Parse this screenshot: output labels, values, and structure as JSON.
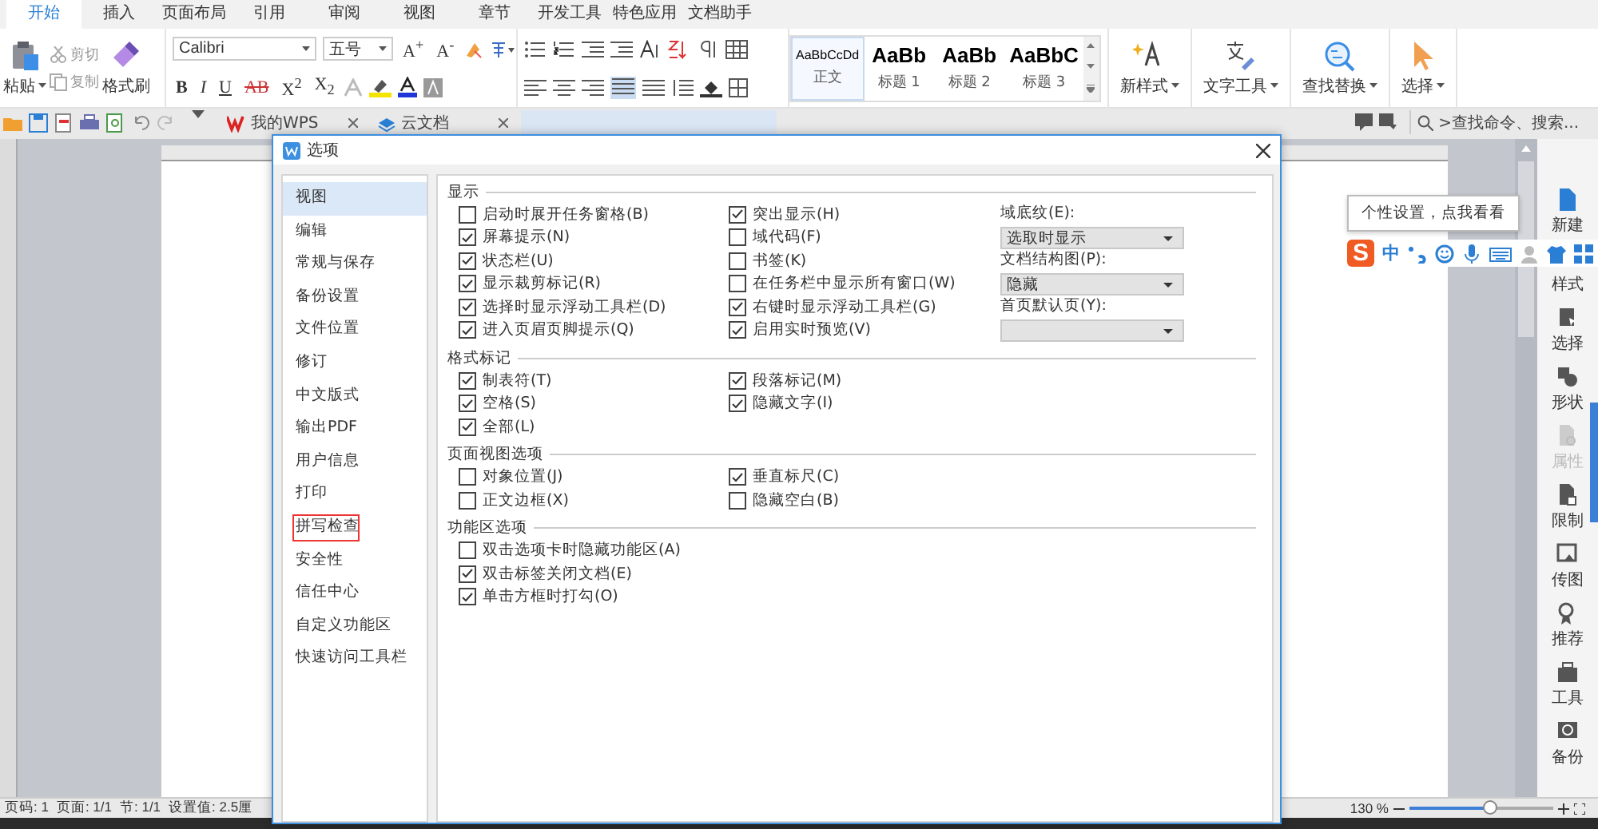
{
  "ribbon_tabs": [
    {
      "label": "开始",
      "selected": true
    },
    {
      "label": "插入",
      "selected": false
    },
    {
      "label": "页面布局",
      "selected": false
    },
    {
      "label": "引用",
      "selected": false
    },
    {
      "label": "审阅",
      "selected": false
    },
    {
      "label": "视图",
      "selected": false
    },
    {
      "label": "章节",
      "selected": false
    },
    {
      "label": "开发工具",
      "selected": false
    },
    {
      "label": "特色应用",
      "selected": false
    },
    {
      "label": "文档助手",
      "selected": false
    }
  ],
  "clipboard": {
    "paste": "粘贴",
    "cut": "剪切",
    "copy": "复制",
    "format_painter": "格式刷"
  },
  "font": {
    "name": "Calibri",
    "size": "五号",
    "size_buttons": [
      "A$^{+}$",
      "A$^{-}$"
    ],
    "format_buttons": [
      "B",
      "I",
      "U",
      "AB",
      "X$^{2}$",
      "X$_{2}$"
    ]
  },
  "styles": [
    {
      "sample": "AaBbCcDd",
      "label": "正文",
      "selected": true
    },
    {
      "sample": "AaBb",
      "label": "标题 1",
      "selected": false
    },
    {
      "sample": "AaBb",
      "label": "标题 2",
      "selected": false
    },
    {
      "sample": "AaBbC",
      "label": "标题 3",
      "selected": false
    }
  ],
  "ribbon_buttons": [
    {
      "kind": "new_style",
      "label": "新样式"
    },
    {
      "kind": "text_tools",
      "label": "文字工具"
    },
    {
      "kind": "find_replace",
      "label": "查找替换"
    },
    {
      "kind": "select",
      "label": "选择"
    }
  ],
  "doc_tabs": [
    {
      "label": "我的WPS",
      "selected": false
    },
    {
      "label": "云文档",
      "selected": false
    },
    {
      "selected": true
    }
  ],
  "command_search": {
    "placeholder": ">查找命令、搜索..."
  },
  "sidebar": [
    {
      "label": "新建",
      "disabled": false
    },
    {
      "label": "样式",
      "disabled": false
    },
    {
      "label": "选择",
      "disabled": false
    },
    {
      "label": "形状",
      "disabled": false
    },
    {
      "label": "属性",
      "disabled": true
    },
    {
      "label": "限制",
      "disabled": false
    },
    {
      "label": "传图",
      "disabled": false
    },
    {
      "label": "推荐",
      "disabled": false
    },
    {
      "label": "工具",
      "disabled": false
    },
    {
      "label": "备份",
      "disabled": false
    }
  ],
  "ime_tooltip": "个性设置，点我看看",
  "ime_bar": {
    "logo": "S",
    "mode": "中"
  },
  "status_bar": {
    "items": [
      "页码: 1",
      "页面: 1/1",
      "节: 1/1",
      "设置值: 2.5厘"
    ],
    "zoom": "130 %",
    "zoom_slider": {
      "level": 0.55
    }
  },
  "dialog": {
    "title": "选项",
    "nav": [
      {
        "label": "视图",
        "selected": true,
        "highlighted": false
      },
      {
        "label": "编辑",
        "selected": false,
        "highlighted": false
      },
      {
        "label": "常规与保存",
        "selected": false,
        "highlighted": false
      },
      {
        "label": "备份设置",
        "selected": false,
        "highlighted": false
      },
      {
        "label": "文件位置",
        "selected": false,
        "highlighted": false
      },
      {
        "label": "修订",
        "selected": false,
        "highlighted": false
      },
      {
        "label": "中文版式",
        "selected": false,
        "highlighted": false
      },
      {
        "label": "输出PDF",
        "selected": false,
        "highlighted": false
      },
      {
        "label": "用户信息",
        "selected": false,
        "highlighted": false
      },
      {
        "label": "打印",
        "selected": false,
        "highlighted": false
      },
      {
        "label": "拼写检查",
        "selected": false,
        "highlighted": true
      },
      {
        "label": "安全性",
        "selected": false,
        "highlighted": false
      },
      {
        "label": "信任中心",
        "selected": false,
        "highlighted": false
      },
      {
        "label": "自定义功能区",
        "selected": false,
        "highlighted": false
      },
      {
        "label": "快速访问工具栏",
        "selected": false,
        "highlighted": false
      }
    ],
    "sections": [
      {
        "title": "显示",
        "columns": [
          [
            {
              "kind": "checkbox",
              "label": "启动时展开任务窗格(B)",
              "checked": false
            },
            {
              "kind": "checkbox",
              "label": "屏幕提示(N)",
              "checked": true
            },
            {
              "kind": "checkbox",
              "label": "状态栏(U)",
              "checked": true
            },
            {
              "kind": "checkbox",
              "label": "显示裁剪标记(R)",
              "checked": true
            },
            {
              "kind": "checkbox",
              "label": "选择时显示浮动工具栏(D)",
              "checked": true
            },
            {
              "kind": "checkbox",
              "label": "进入页眉页脚提示(Q)",
              "checked": true
            }
          ],
          [
            {
              "kind": "checkbox",
              "label": "突出显示(H)",
              "checked": true
            },
            {
              "kind": "checkbox",
              "label": "域代码(F)",
              "checked": false
            },
            {
              "kind": "checkbox",
              "label": "书签(K)",
              "checked": false
            },
            {
              "kind": "checkbox",
              "label": "在任务栏中显示所有窗口(W)",
              "checked": false
            },
            {
              "kind": "checkbox",
              "label": "右键时显示浮动工具栏(G)",
              "checked": true
            },
            {
              "kind": "checkbox",
              "label": "启用实时预览(V)",
              "checked": true
            }
          ],
          [
            {
              "kind": "label",
              "label": "域底纹(E):"
            },
            {
              "kind": "dropdown",
              "value": "选取时显示"
            },
            {
              "kind": "label",
              "label": "文档结构图(P):"
            },
            {
              "kind": "dropdown",
              "value": "隐藏"
            },
            {
              "kind": "label",
              "label": "首页默认页(Y):"
            },
            {
              "kind": "dropdown"
            }
          ]
        ]
      },
      {
        "title": "格式标记",
        "columns": [
          [
            {
              "kind": "checkbox",
              "label": "制表符(T)",
              "checked": true
            },
            {
              "kind": "checkbox",
              "label": "空格(S)",
              "checked": true
            },
            {
              "kind": "checkbox",
              "label": "全部(L)",
              "checked": true
            }
          ],
          [
            {
              "kind": "checkbox",
              "label": "段落标记(M)",
              "checked": true
            },
            {
              "kind": "checkbox",
              "label": "隐藏文字(I)",
              "checked": true
            }
          ]
        ]
      },
      {
        "title": "页面视图选项",
        "columns": [
          [
            {
              "kind": "checkbox",
              "label": "对象位置(J)",
              "checked": false
            },
            {
              "kind": "checkbox",
              "label": "正文边框(X)",
              "checked": false
            }
          ],
          [
            {
              "kind": "checkbox",
              "label": "垂直标尺(C)",
              "checked": true
            },
            {
              "kind": "checkbox",
              "label": "隐藏空白(B)",
              "checked": false
            }
          ]
        ]
      },
      {
        "title": "功能区选项",
        "columns": [
          [
            {
              "kind": "checkbox",
              "label": "双击选项卡时隐藏功能区(A)",
              "checked": false
            },
            {
              "kind": "checkbox",
              "label": "双击标签关闭文档(E)",
              "checked": true
            },
            {
              "kind": "checkbox",
              "label": "单击方框时打勾(O)",
              "checked": true
            }
          ]
        ]
      }
    ]
  }
}
